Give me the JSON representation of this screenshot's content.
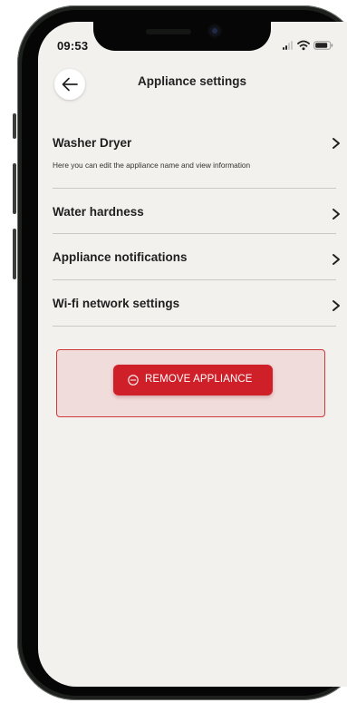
{
  "status_bar": {
    "time": "09:53",
    "icons": [
      "cellular-signal-icon",
      "wifi-icon",
      "battery-icon"
    ]
  },
  "header": {
    "back_icon": "arrow-left-icon",
    "title": "Appliance settings"
  },
  "settings": [
    {
      "title": "Washer Dryer",
      "subtitle": "Here you can edit the appliance name and view information"
    },
    {
      "title": "Water hardness"
    },
    {
      "title": "Appliance notifications"
    },
    {
      "title": "Wi-fi network settings"
    }
  ],
  "remove_panel": {
    "button_label": "REMOVE APPLIANCE",
    "button_icon": "minus-circle-icon"
  },
  "colors": {
    "background": "#f2f1ed",
    "danger": "#cf1f28",
    "danger_panel": "#f1dcdc",
    "text": "#1f1f1f"
  }
}
